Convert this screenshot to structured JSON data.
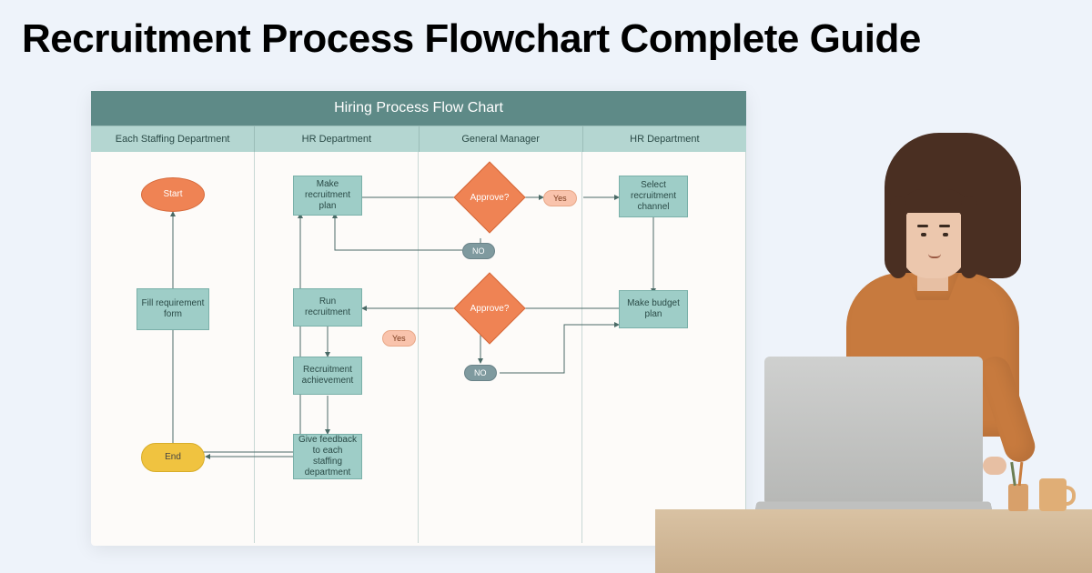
{
  "page": {
    "title": "Recruitment Process Flowchart Complete Guide"
  },
  "flowchart": {
    "title": "Hiring Process Flow Chart",
    "lanes": [
      "Each Staffing Department",
      "HR Department",
      "General Manager",
      "HR Department"
    ],
    "nodes": {
      "start": "Start",
      "fill_req": "Fill requirement form",
      "make_plan": "Make recruitment plan",
      "approve1": "Approve?",
      "yes1": "Yes",
      "no1": "NO",
      "select_channel": "Select recruitment channel",
      "make_budget": "Make budget plan",
      "approve2": "Approve?",
      "yes2": "Yes",
      "no2": "NO",
      "run_recruitment": "Run recruitment",
      "achievement": "Recruitment achievement",
      "feedback": "Give feedback to each staffing department",
      "end": "End"
    }
  }
}
